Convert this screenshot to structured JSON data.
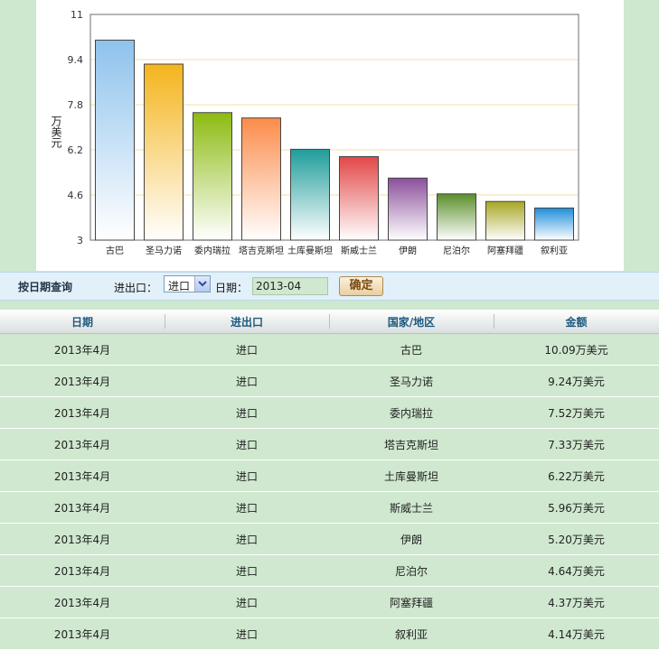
{
  "chart_data": {
    "type": "bar",
    "ylabel": "万美元",
    "ylim": [
      3,
      11
    ],
    "yticks": [
      "3",
      "4.6",
      "6.2",
      "7.8",
      "9.4",
      "11"
    ],
    "categories": [
      "古巴",
      "圣马力诺",
      "委内瑞拉",
      "塔吉克斯坦",
      "土库曼斯坦",
      "斯威士兰",
      "伊朗",
      "尼泊尔",
      "阿塞拜疆",
      "叙利亚"
    ],
    "values": [
      10.09,
      9.24,
      7.52,
      7.33,
      6.22,
      5.96,
      5.2,
      4.64,
      4.37,
      4.14
    ],
    "colors": [
      "#8ec2ec",
      "#f4b41c",
      "#8cbb12",
      "#fb8c4a",
      "#1f9d9b",
      "#e24747",
      "#8c4f9c",
      "#5a8e2a",
      "#a7a624",
      "#1f8fdb"
    ],
    "grid": true,
    "legend": "none"
  },
  "query": {
    "title": "按日期查询",
    "io_label": "进出口：",
    "io_value": "进口",
    "date_label": "日期：",
    "date_value": "2013-04",
    "submit_label": "确定"
  },
  "table": {
    "headers": [
      "日期",
      "进出口",
      "国家/地区",
      "金额"
    ],
    "rows": [
      [
        "2013年4月",
        "进口",
        "古巴",
        "10.09万美元"
      ],
      [
        "2013年4月",
        "进口",
        "圣马力诺",
        "9.24万美元"
      ],
      [
        "2013年4月",
        "进口",
        "委内瑞拉",
        "7.52万美元"
      ],
      [
        "2013年4月",
        "进口",
        "塔吉克斯坦",
        "7.33万美元"
      ],
      [
        "2013年4月",
        "进口",
        "土库曼斯坦",
        "6.22万美元"
      ],
      [
        "2013年4月",
        "进口",
        "斯威士兰",
        "5.96万美元"
      ],
      [
        "2013年4月",
        "进口",
        "伊朗",
        "5.20万美元"
      ],
      [
        "2013年4月",
        "进口",
        "尼泊尔",
        "4.64万美元"
      ],
      [
        "2013年4月",
        "进口",
        "阿塞拜疆",
        "4.37万美元"
      ],
      [
        "2013年4月",
        "进口",
        "叙利亚",
        "4.14万美元"
      ]
    ]
  }
}
